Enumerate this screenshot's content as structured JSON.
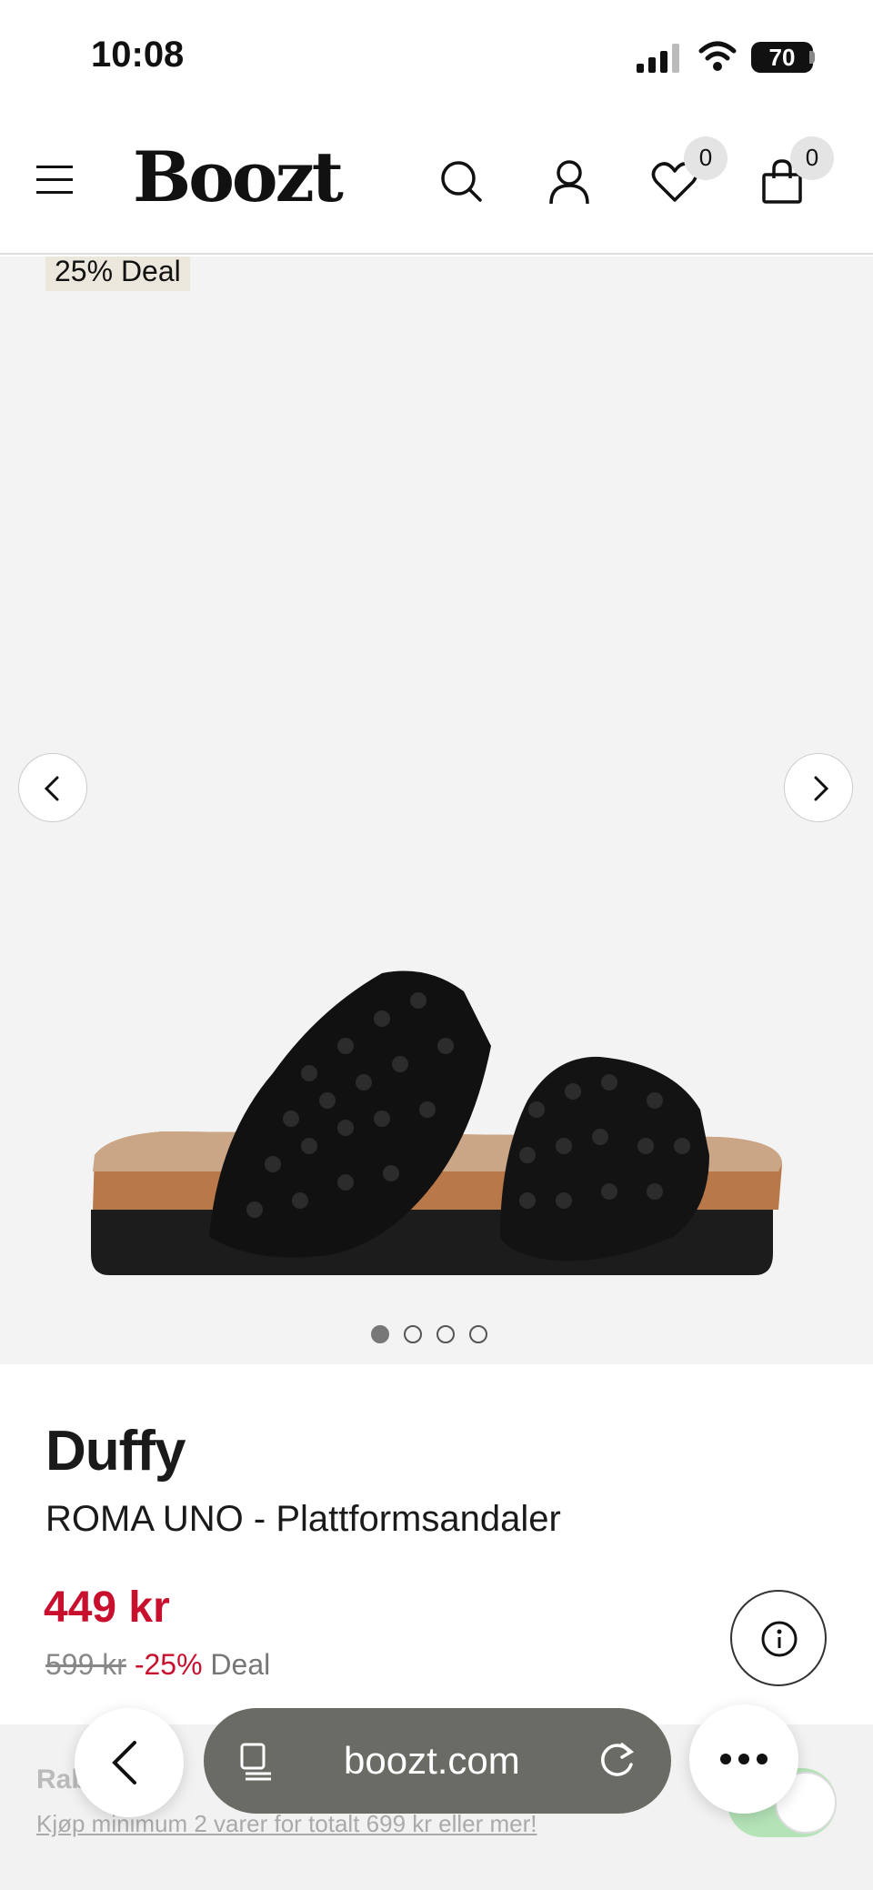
{
  "status_bar": {
    "time": "10:08",
    "battery": "70"
  },
  "header": {
    "logo": "Boozt",
    "wishlist_count": "0",
    "cart_count": "0",
    "icons": [
      "menu-icon",
      "search-icon",
      "user-icon",
      "heart-icon",
      "bag-icon"
    ]
  },
  "gallery": {
    "deal_tag": "25% Deal",
    "image_count": 4,
    "active_index": 0
  },
  "product": {
    "brand": "Duffy",
    "name": "ROMA UNO - Plattformsandaler",
    "price": "449 kr",
    "old_price": "599 kr",
    "discount": "-25%",
    "deal_label": "Deal"
  },
  "promo": {
    "title": "Rabatt",
    "subtitle": "Kjøp minimum 2 varer for totalt 699 kr eller mer!"
  },
  "browser": {
    "url": "boozt.com"
  },
  "colors": {
    "price_red": "#c8102e",
    "gallery_bg": "#f3f3f3",
    "toggle_green": "#b5e3b8"
  }
}
